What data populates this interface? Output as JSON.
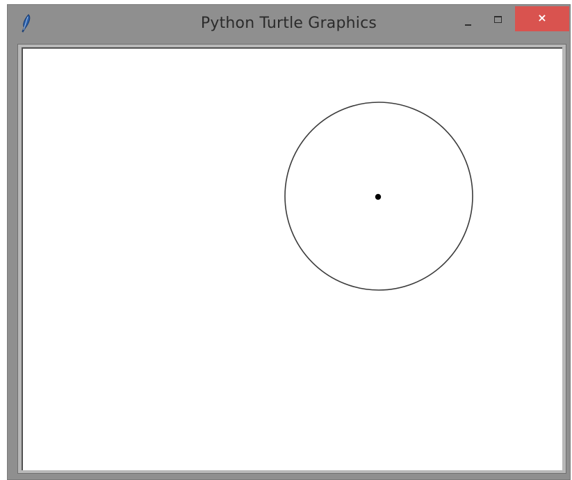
{
  "window": {
    "title": "Python Turtle Graphics",
    "close_label": "×",
    "close_color": "#d9534f"
  },
  "icons": {
    "app": "feather-icon",
    "minimize": "minimize-icon",
    "maximize": "maximize-icon",
    "close": "close-icon"
  },
  "canvas": {
    "background": "#ffffff",
    "shapes": [
      "circle-outline",
      "center-dot"
    ]
  }
}
